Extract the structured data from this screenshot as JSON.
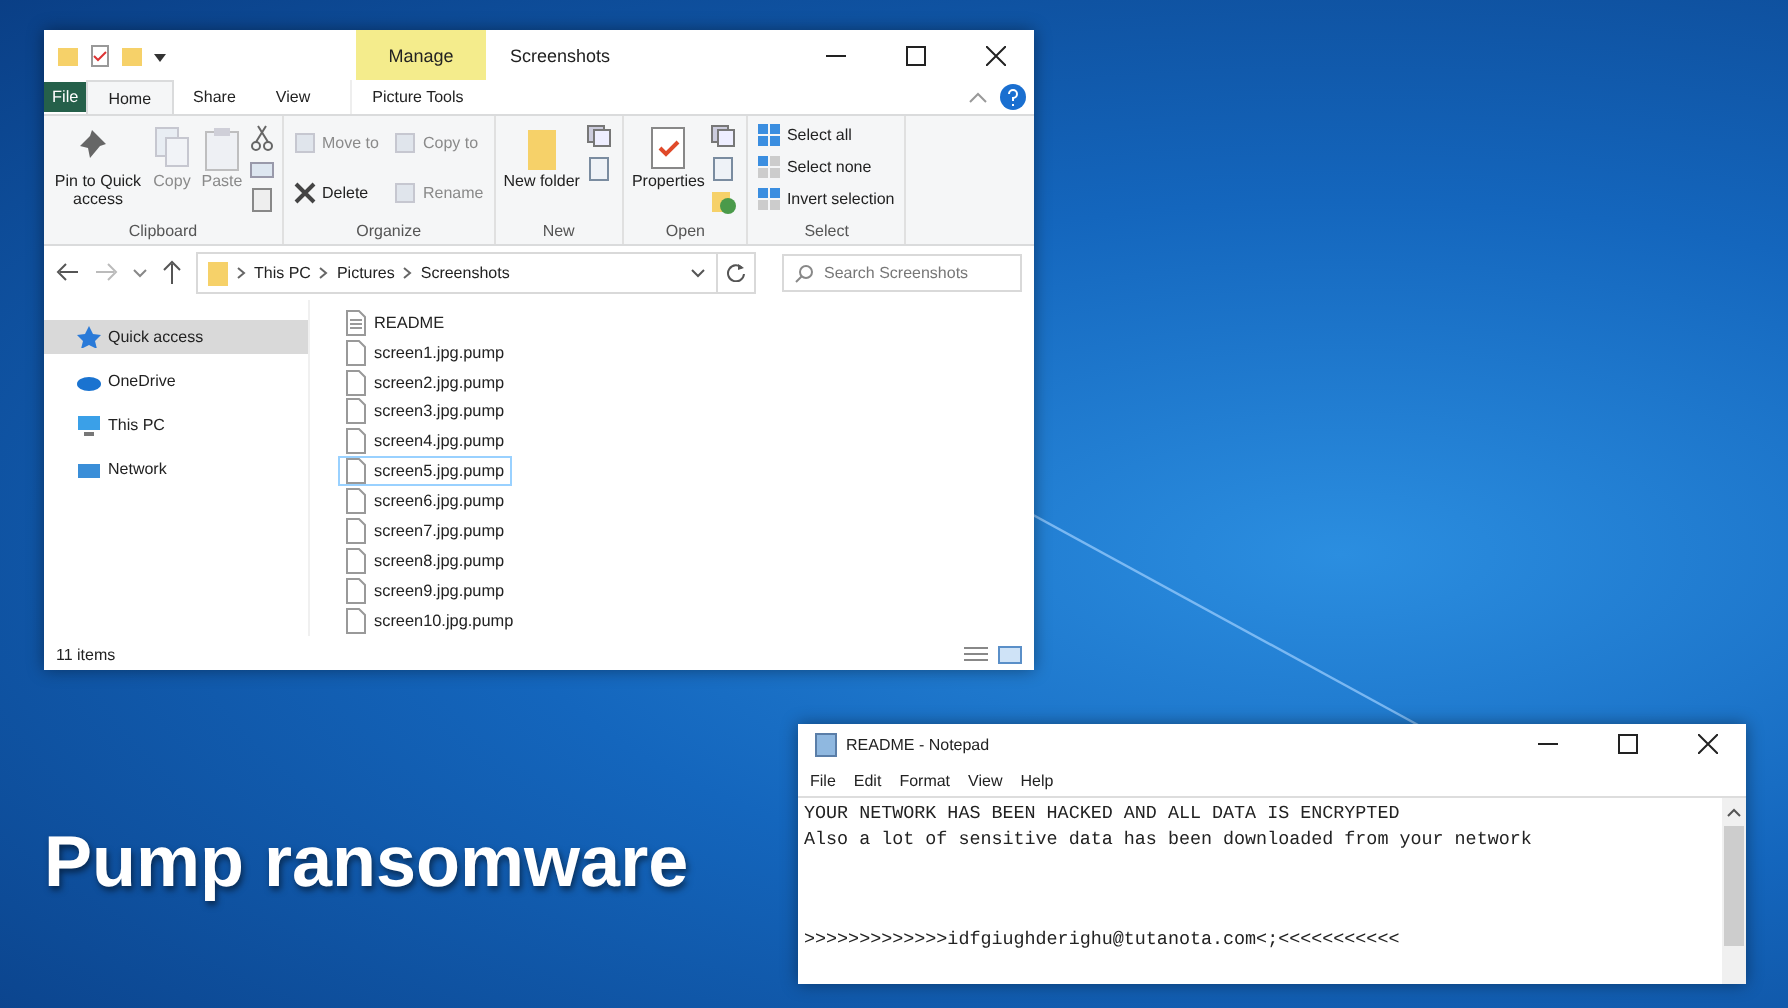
{
  "explorer": {
    "title": "Screenshots",
    "context_tab": "Manage",
    "tabs": [
      {
        "label": "File",
        "kind": "file",
        "selected": false
      },
      {
        "label": "Home",
        "kind": "tab",
        "selected": true
      },
      {
        "label": "Share",
        "kind": "tab",
        "selected": false
      },
      {
        "label": "View",
        "kind": "tab",
        "selected": false
      },
      {
        "label": "Picture Tools",
        "kind": "context",
        "selected": false
      }
    ],
    "ribbon": [
      {
        "label": "Clipboard",
        "items": [
          {
            "label": "Pin to Quick access",
            "kind": "large",
            "disabled": false
          },
          {
            "label": "Copy",
            "kind": "large",
            "disabled": true
          },
          {
            "label": "Paste",
            "kind": "large",
            "disabled": true
          },
          {
            "kind": "icons",
            "disabled": false
          }
        ]
      },
      {
        "label": "Organize",
        "items": [
          {
            "label": "Move to",
            "kind": "small",
            "disabled": true
          },
          {
            "label": "Copy to",
            "kind": "small",
            "disabled": true
          },
          {
            "label": "Delete",
            "kind": "small",
            "disabled": false
          },
          {
            "label": "Rename",
            "kind": "small",
            "disabled": true
          }
        ]
      },
      {
        "label": "New",
        "items": [
          {
            "label": "New folder",
            "kind": "large",
            "disabled": false
          },
          {
            "kind": "icons",
            "disabled": false
          }
        ]
      },
      {
        "label": "Open",
        "items": [
          {
            "label": "Properties",
            "kind": "large",
            "disabled": false
          },
          {
            "kind": "icons",
            "disabled": false
          }
        ]
      },
      {
        "label": "Select",
        "items": [
          {
            "label": "Select all",
            "kind": "small",
            "disabled": false
          },
          {
            "label": "Select none",
            "kind": "small",
            "disabled": false
          },
          {
            "label": "Invert selection",
            "kind": "small",
            "disabled": false
          }
        ]
      }
    ],
    "breadcrumbs": [
      "This PC",
      "Pictures",
      "Screenshots"
    ],
    "search": {
      "placeholder": "Search Screenshots"
    },
    "nav": [
      {
        "label": "Quick access",
        "selected": true
      },
      {
        "label": "OneDrive",
        "selected": false
      },
      {
        "label": "This PC",
        "selected": false
      },
      {
        "label": "Network",
        "selected": false
      }
    ],
    "files": [
      {
        "name": "README",
        "kind": "text",
        "selected": false
      },
      {
        "name": "screen1.jpg.pump",
        "kind": "file",
        "selected": false
      },
      {
        "name": "screen2.jpg.pump",
        "kind": "file",
        "selected": false
      },
      {
        "name": "screen3.jpg.pump",
        "kind": "file",
        "selected": false
      },
      {
        "name": "screen4.jpg.pump",
        "kind": "file",
        "selected": false
      },
      {
        "name": "screen5.jpg.pump",
        "kind": "file",
        "selected": true
      },
      {
        "name": "screen6.jpg.pump",
        "kind": "file",
        "selected": false
      },
      {
        "name": "screen7.jpg.pump",
        "kind": "file",
        "selected": false
      },
      {
        "name": "screen8.jpg.pump",
        "kind": "file",
        "selected": false
      },
      {
        "name": "screen9.jpg.pump",
        "kind": "file",
        "selected": false
      },
      {
        "name": "screen10.jpg.pump",
        "kind": "file",
        "selected": false
      }
    ],
    "status_bar": "11 items"
  },
  "notepad": {
    "title": "README - Notepad",
    "menu": [
      "File",
      "Edit",
      "Format",
      "View",
      "Help"
    ],
    "paragraphs": [
      {
        "lines": [
          "YOUR NETWORK HAS BEEN HACKED AND ALL DATA IS ENCRYPTED",
          "Also a lot of sensitive data has been downloaded from your network"
        ]
      },
      {
        "lines": [
          ">>>>>>>>>>>>>idfgiughderighu@tutanota.com<;<<<<<<<<<<<"
        ]
      }
    ]
  },
  "headline": "Pump ransomware"
}
